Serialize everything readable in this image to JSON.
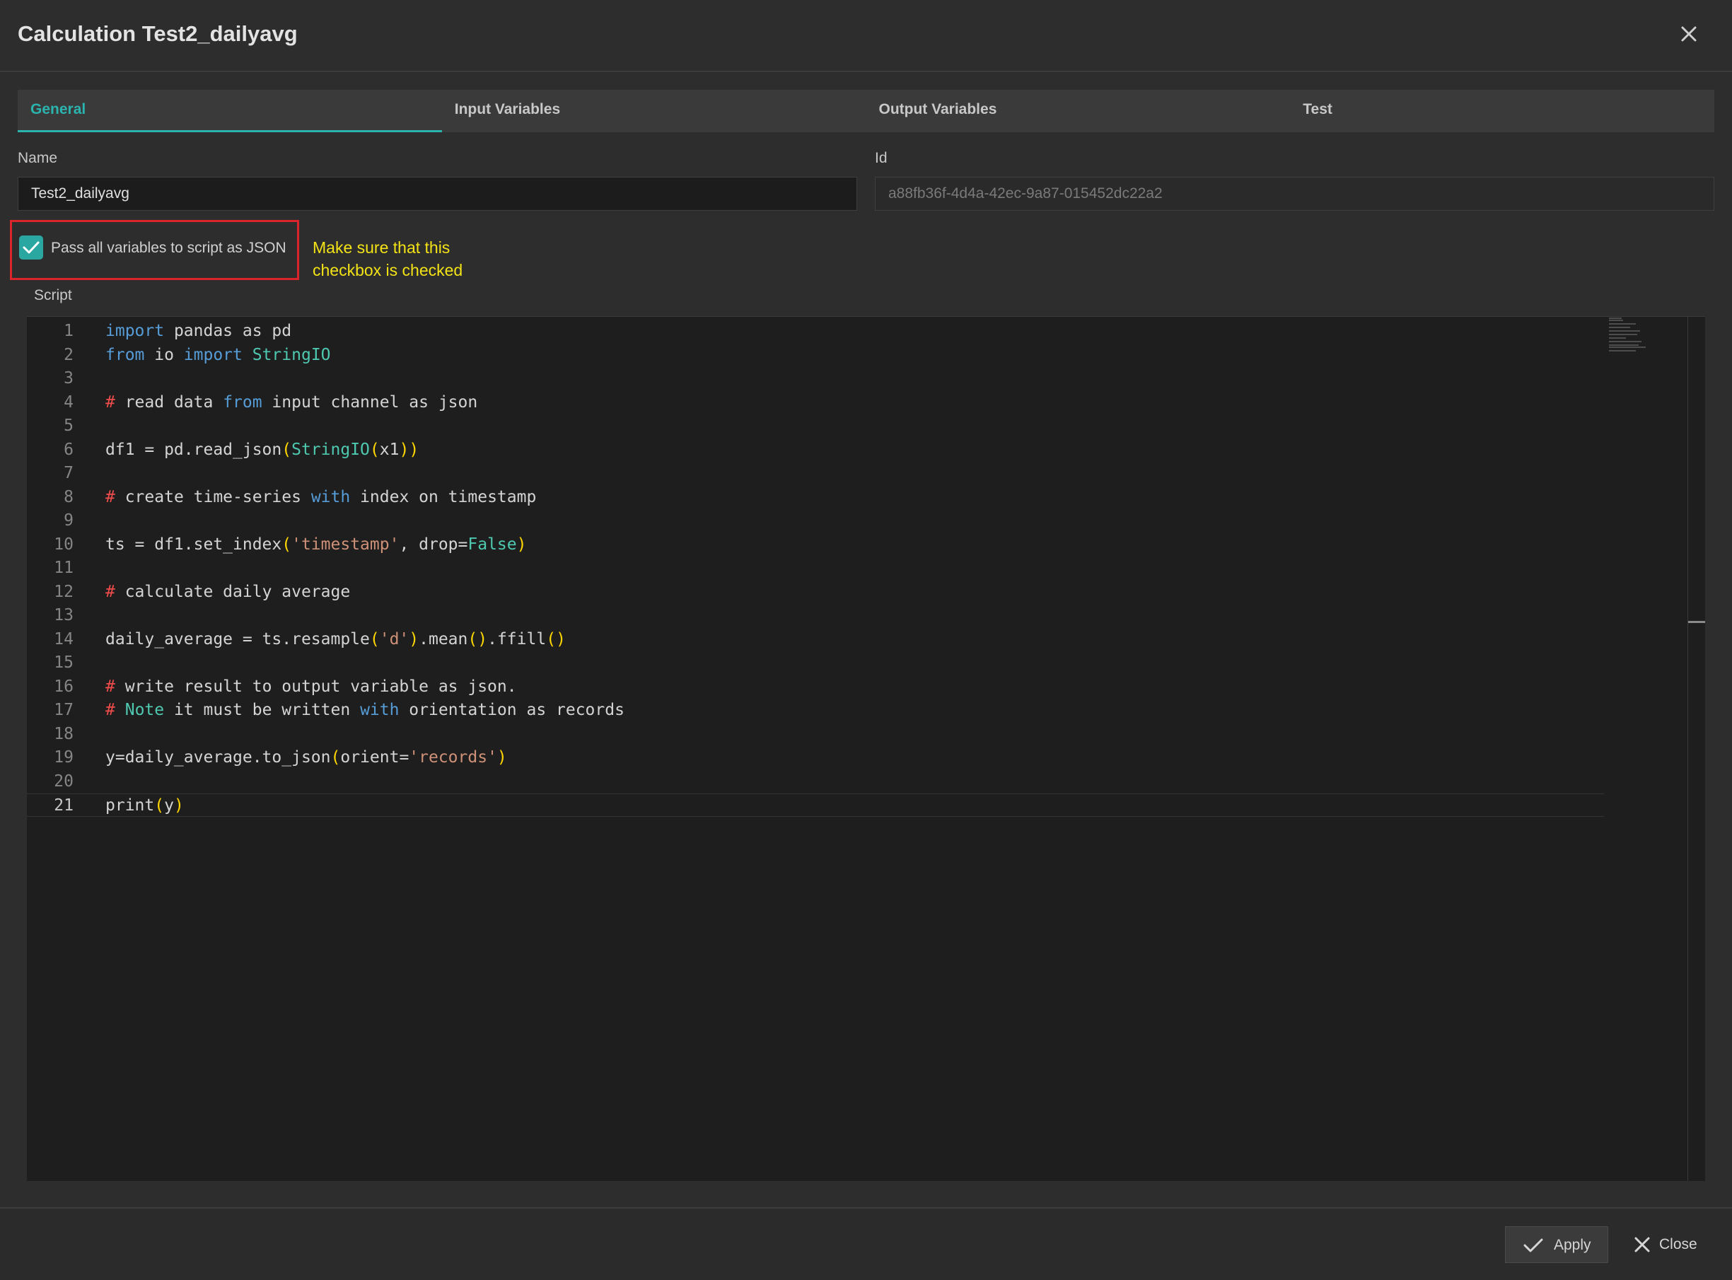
{
  "dialog": {
    "title": "Calculation Test2_dailyavg"
  },
  "tabs": [
    {
      "label": "General",
      "active": true
    },
    {
      "label": "Input Variables",
      "active": false
    },
    {
      "label": "Output Variables",
      "active": false
    },
    {
      "label": "Test",
      "active": false
    }
  ],
  "form": {
    "name_label": "Name",
    "name_value": "Test2_dailyavg",
    "id_label": "Id",
    "id_value": "a88fb36f-4d4a-42ec-9a87-015452dc22a2",
    "checkbox_label": "Pass all variables to script as JSON",
    "checkbox_checked": true,
    "annotation_line1": "Make sure that this",
    "annotation_line2": "checkbox is checked",
    "script_label": "Script"
  },
  "script": {
    "current_line": 21,
    "lines": [
      "import pandas as pd",
      "from io import StringIO",
      "",
      "# read data from input channel as json",
      "",
      "df1 = pd.read_json(StringIO(x1))",
      "",
      "# create time-series with index on timestamp",
      "",
      "ts = df1.set_index('timestamp', drop=False)",
      "",
      "# calculate daily average",
      "",
      "daily_average = ts.resample('d').mean().ffill()",
      "",
      "# write result to output variable as json.",
      "# Note it must be written with orientation as records",
      "",
      "y=daily_average.to_json(orient='records')",
      "",
      "print(y)"
    ]
  },
  "footer": {
    "apply_label": "Apply",
    "close_label": "Close"
  },
  "colors": {
    "accent": "#2bb3ad",
    "annotation": "#f3e316",
    "highlight_border": "#d9252b",
    "editor_bg": "#1e1e1e"
  },
  "icons": [
    "close-icon",
    "checkmark-icon",
    "apply-check-icon",
    "close-x-icon"
  ]
}
